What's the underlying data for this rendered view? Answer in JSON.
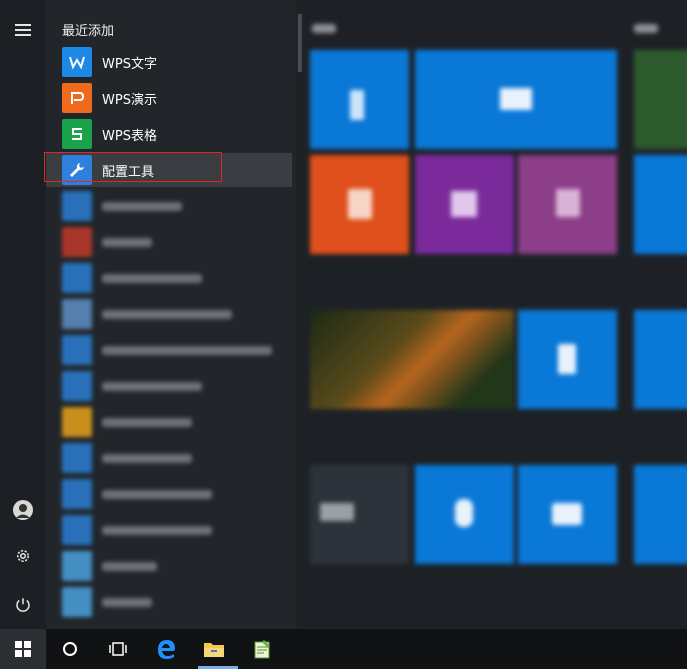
{
  "start_menu": {
    "section_label": "最近添加",
    "apps": [
      {
        "name": "WPS文字",
        "color": "#1e88e5",
        "icon": "wps-writer-icon",
        "glyph": "W"
      },
      {
        "name": "WPS演示",
        "color": "#f06a1d",
        "icon": "wps-presentation-icon",
        "glyph": "P"
      },
      {
        "name": "WPS表格",
        "color": "#19a34a",
        "icon": "wps-spreadsheet-icon",
        "glyph": "S"
      },
      {
        "name": "配置工具",
        "color": "#2f7fdc",
        "icon": "wrench-icon",
        "glyph": "🔧"
      }
    ],
    "selected_index": 3,
    "highlight_color": "#e02626"
  },
  "colors": {
    "accent": "#0a78d7",
    "orange": "#e0501c",
    "purple": "#7b2a9c",
    "mauve": "#8c3e88"
  },
  "taskbar": {
    "items": [
      "start-icon",
      "cortana-icon",
      "task-view-icon",
      "edge-icon",
      "file-explorer-icon",
      "notepad-icon"
    ]
  }
}
